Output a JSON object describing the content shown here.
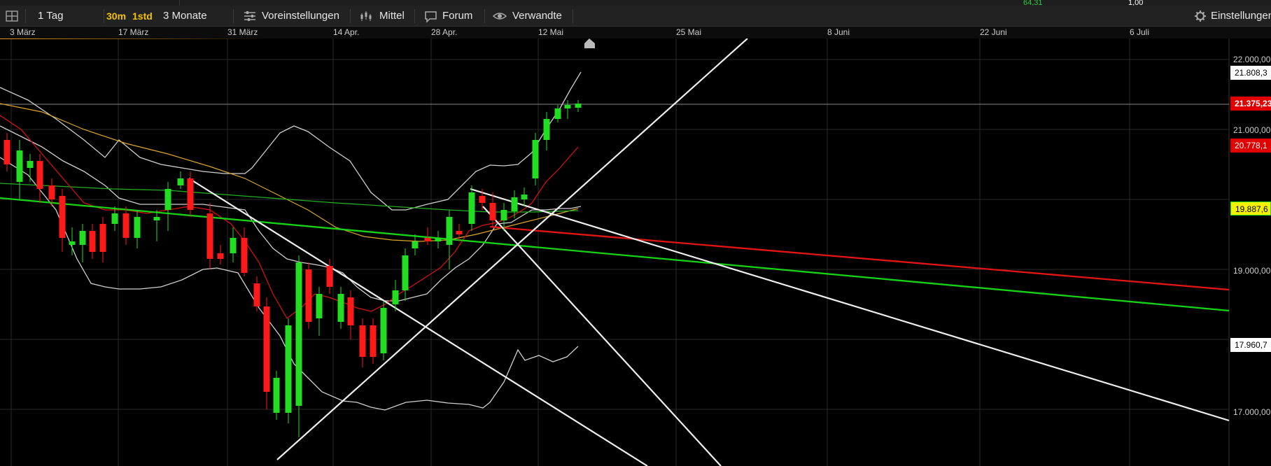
{
  "top_strip": {
    "value_left": "64,31",
    "value_right": "1,00"
  },
  "toolbar": {
    "interval": "1 Tag",
    "quick_30m": "30m",
    "quick_1std": "1std",
    "range": "3 Monate",
    "settings_presets": "Voreinstellungen",
    "average": "Mittel",
    "forum": "Forum",
    "related": "Verwandte",
    "settings": "Einstellungen"
  },
  "x_axis_labels": [
    "3 März",
    "17 März",
    "31 März",
    "14 Apr.",
    "28 Apr.",
    "12 Mai",
    "25 Mai",
    "8 Juni",
    "22 Juni",
    "6 Juli"
  ],
  "y_axis_labels": [
    "22.000,00",
    "21.000,00",
    "19.000,00",
    "17.000,00"
  ],
  "price_tags": {
    "upper_band": "21.808,3",
    "last_price": "21.375,23",
    "ma_red": "20.778,1",
    "ma_green_yellow": "19.887,6",
    "lower_band": "17.960,7"
  },
  "colors": {
    "up": "#22dd22",
    "down": "#ff1a1a",
    "background": "#000000",
    "toolbar": "#222222"
  }
}
